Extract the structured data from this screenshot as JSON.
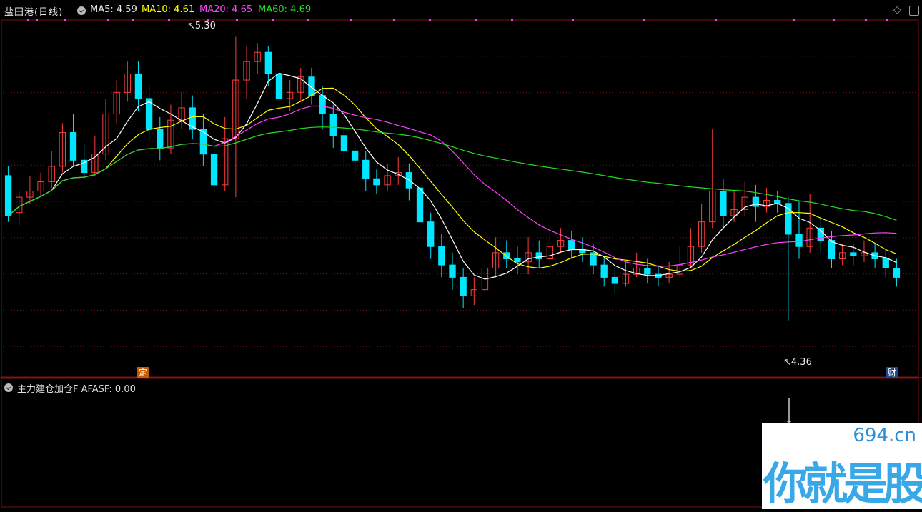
{
  "header": {
    "title": "盐田港(日线)",
    "ma5": "MA5: 4.59",
    "ma10": "MA10: 4.61",
    "ma20": "MA20: 4.65",
    "ma60": "MA60: 4.69"
  },
  "annotations": {
    "high": "5.30",
    "low": "4.36"
  },
  "markers": {
    "ding": "定",
    "cai": "财"
  },
  "indicator": {
    "label": "主力建仓加仓F  AFASF: 0.00"
  },
  "watermark": {
    "url": "694.cn",
    "slogan": "你就是股神"
  },
  "colors": {
    "up": "#ff3c3c",
    "down": "#00e6ff",
    "ma5": "#ffffff",
    "ma10": "#ffff00",
    "ma20": "#ff44ff",
    "ma60": "#22dd22",
    "grid": "#7a1010"
  },
  "chart_data": {
    "type": "candlestick",
    "price_range": [
      4.25,
      5.35
    ],
    "candles": [
      [
        4.85,
        4.72,
        4.88,
        4.7
      ],
      [
        4.73,
        4.78,
        4.8,
        4.69
      ],
      [
        4.78,
        4.8,
        4.85,
        4.76
      ],
      [
        4.8,
        4.83,
        4.86,
        4.78
      ],
      [
        4.83,
        4.88,
        4.93,
        4.81
      ],
      [
        4.88,
        4.99,
        5.02,
        4.86
      ],
      [
        4.99,
        4.9,
        5.05,
        4.88
      ],
      [
        4.9,
        4.86,
        4.95,
        4.84
      ],
      [
        4.86,
        4.92,
        4.98,
        4.85
      ],
      [
        4.92,
        5.05,
        5.1,
        4.9
      ],
      [
        5.05,
        5.12,
        5.16,
        5.02
      ],
      [
        5.12,
        5.18,
        5.22,
        5.09
      ],
      [
        5.18,
        5.1,
        5.22,
        5.06
      ],
      [
        5.1,
        5.0,
        5.14,
        4.96
      ],
      [
        5.0,
        4.94,
        5.04,
        4.9
      ],
      [
        4.94,
        5.03,
        5.08,
        4.92
      ],
      [
        5.03,
        5.07,
        5.12,
        5.0
      ],
      [
        5.07,
        5.0,
        5.11,
        4.97
      ],
      [
        5.0,
        4.92,
        5.05,
        4.88
      ],
      [
        4.92,
        4.82,
        4.98,
        4.8
      ],
      [
        4.82,
        4.97,
        5.04,
        4.8
      ],
      [
        4.97,
        5.16,
        5.3,
        4.78
      ],
      [
        5.16,
        5.22,
        5.27,
        5.1
      ],
      [
        5.22,
        5.25,
        5.28,
        5.18
      ],
      [
        5.25,
        5.18,
        5.27,
        5.14
      ],
      [
        5.18,
        5.1,
        5.22,
        5.07
      ],
      [
        5.1,
        5.12,
        5.16,
        5.06
      ],
      [
        5.12,
        5.17,
        5.2,
        5.09
      ],
      [
        5.17,
        5.11,
        5.2,
        5.08
      ],
      [
        5.11,
        5.05,
        5.14,
        5.0
      ],
      [
        5.05,
        4.98,
        5.08,
        4.94
      ],
      [
        4.98,
        4.93,
        5.01,
        4.89
      ],
      [
        4.93,
        4.9,
        4.96,
        4.86
      ],
      [
        4.9,
        4.84,
        4.93,
        4.8
      ],
      [
        4.84,
        4.82,
        4.87,
        4.79
      ],
      [
        4.82,
        4.85,
        4.89,
        4.8
      ],
      [
        4.85,
        4.86,
        4.91,
        4.82
      ],
      [
        4.86,
        4.81,
        4.89,
        4.77
      ],
      [
        4.81,
        4.7,
        4.84,
        4.66
      ],
      [
        4.7,
        4.62,
        4.73,
        4.58
      ],
      [
        4.62,
        4.56,
        4.66,
        4.52
      ],
      [
        4.56,
        4.52,
        4.6,
        4.48
      ],
      [
        4.52,
        4.46,
        4.55,
        4.42
      ],
      [
        4.46,
        4.48,
        4.52,
        4.43
      ],
      [
        4.48,
        4.55,
        4.6,
        4.46
      ],
      [
        4.55,
        4.6,
        4.65,
        4.52
      ],
      [
        4.6,
        4.58,
        4.64,
        4.55
      ],
      [
        4.58,
        4.57,
        4.62,
        4.53
      ],
      [
        4.57,
        4.6,
        4.65,
        4.53
      ],
      [
        4.6,
        4.58,
        4.64,
        4.55
      ],
      [
        4.58,
        4.62,
        4.67,
        4.56
      ],
      [
        4.62,
        4.64,
        4.68,
        4.6
      ],
      [
        4.64,
        4.61,
        4.67,
        4.58
      ],
      [
        4.61,
        4.6,
        4.65,
        4.57
      ],
      [
        4.6,
        4.56,
        4.63,
        4.53
      ],
      [
        4.56,
        4.52,
        4.59,
        4.49
      ],
      [
        4.52,
        4.5,
        4.55,
        4.47
      ],
      [
        4.5,
        4.53,
        4.57,
        4.49
      ],
      [
        4.53,
        4.55,
        4.6,
        4.52
      ],
      [
        4.55,
        4.53,
        4.58,
        4.5
      ],
      [
        4.53,
        4.52,
        4.56,
        4.49
      ],
      [
        4.52,
        4.53,
        4.57,
        4.5
      ],
      [
        4.53,
        4.56,
        4.62,
        4.52
      ],
      [
        4.56,
        4.62,
        4.68,
        4.55
      ],
      [
        4.62,
        4.7,
        4.76,
        4.6
      ],
      [
        4.7,
        4.8,
        5.0,
        4.68
      ],
      [
        4.8,
        4.72,
        4.84,
        4.68
      ],
      [
        4.72,
        4.74,
        4.8,
        4.7
      ],
      [
        4.74,
        4.78,
        4.83,
        4.72
      ],
      [
        4.78,
        4.75,
        4.82,
        4.7
      ],
      [
        4.75,
        4.77,
        4.81,
        4.73
      ],
      [
        4.77,
        4.76,
        4.8,
        4.73
      ],
      [
        4.76,
        4.66,
        4.78,
        4.38
      ],
      [
        4.66,
        4.62,
        4.77,
        4.58
      ],
      [
        4.62,
        4.68,
        4.79,
        4.6
      ],
      [
        4.68,
        4.64,
        4.72,
        4.6
      ],
      [
        4.64,
        4.58,
        4.67,
        4.55
      ],
      [
        4.58,
        4.6,
        4.63,
        4.56
      ],
      [
        4.6,
        4.59,
        4.63,
        4.56
      ],
      [
        4.59,
        4.6,
        4.64,
        4.57
      ],
      [
        4.6,
        4.58,
        4.63,
        4.55
      ],
      [
        4.58,
        4.55,
        4.61,
        4.52
      ],
      [
        4.55,
        4.52,
        4.58,
        4.49
      ]
    ]
  }
}
